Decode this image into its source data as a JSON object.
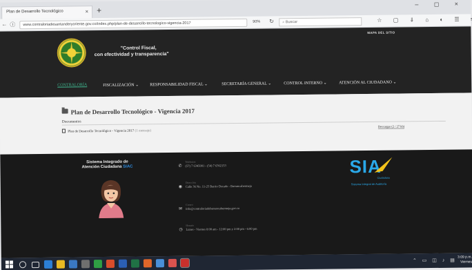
{
  "browser": {
    "tab_title": "Plan de Desarrollo Tecnológico",
    "tab_close": "×",
    "new_tab": "+",
    "url": "www.contraloriadesantanderyoriente.gov.co/index.php/plan-de-desarrollo-tecnologico-vigencia-2017",
    "zoom": "90%",
    "search_placeholder": "Buscar",
    "window_controls": "– ◻ ×"
  },
  "header": {
    "slogan_line1": "\"Control Fiscal,",
    "slogan_line2": "con efectividad y transparencia\"",
    "top_right": "MAPA DEL SITIO",
    "nav": [
      {
        "label": "CONTRALORÍA"
      },
      {
        "label": "FISCALIZACIÓN ⌄"
      },
      {
        "label": "RESPONSABILIDAD FISCAL ⌄"
      },
      {
        "label": "SECRETARÍA GENERAL ⌄"
      },
      {
        "label": "CONTROL INTERNO ⌄"
      },
      {
        "label": "ATENCIÓN AL CIUDADANO ⌄"
      }
    ]
  },
  "content": {
    "title": "Plan de Desarrollo Tecnológico - Vigencia 2017",
    "section_label": "Documentos",
    "doc_link": "Plan de Desarrollo Tecnológico - Vigencia 2017",
    "doc_sub": "(1 mensaje)",
    "doc_count": "Descargas (2 / 27 kb)"
  },
  "footer": {
    "title_line1": "Sistema Integrado de",
    "title_line2": "Atención Ciudadana",
    "title_accent": "SIAC",
    "contacts": [
      {
        "icon": "phone-icon",
        "glyph": "✆",
        "head": "Teléfonos",
        "text": "(57) 7 6345001 - (54) 7 6362153"
      },
      {
        "icon": "location-icon",
        "glyph": "◉",
        "head": "Dirección",
        "text": "Calle 36 No. 11-25 Barrio Dorado - Barrancabermeja"
      },
      {
        "icon": "email-icon",
        "glyph": "✉",
        "head": "Correo",
        "text": "info@contraloriadebarrancabermeja.gov.co"
      },
      {
        "icon": "clock-icon",
        "glyph": "◷",
        "head": "Horario",
        "text": "Lunes - Viernes 8:00 am - 12:00 pm y 2:00 pm - 6:00 pm"
      }
    ],
    "sia_word": "SIA",
    "sia_sub1": "Ciudadano",
    "sia_sub2": "Sistema Integral de Auditoría"
  },
  "taskbar": {
    "clock_time": "3:09 p.m.",
    "clock_date": "Viernes"
  },
  "colors": {
    "nav_active": "#3fb58e",
    "siac_accent": "#2f8de0",
    "sia_brand": "#2aa8e8",
    "header_bg": "#232323",
    "footer_bg": "#191919"
  }
}
